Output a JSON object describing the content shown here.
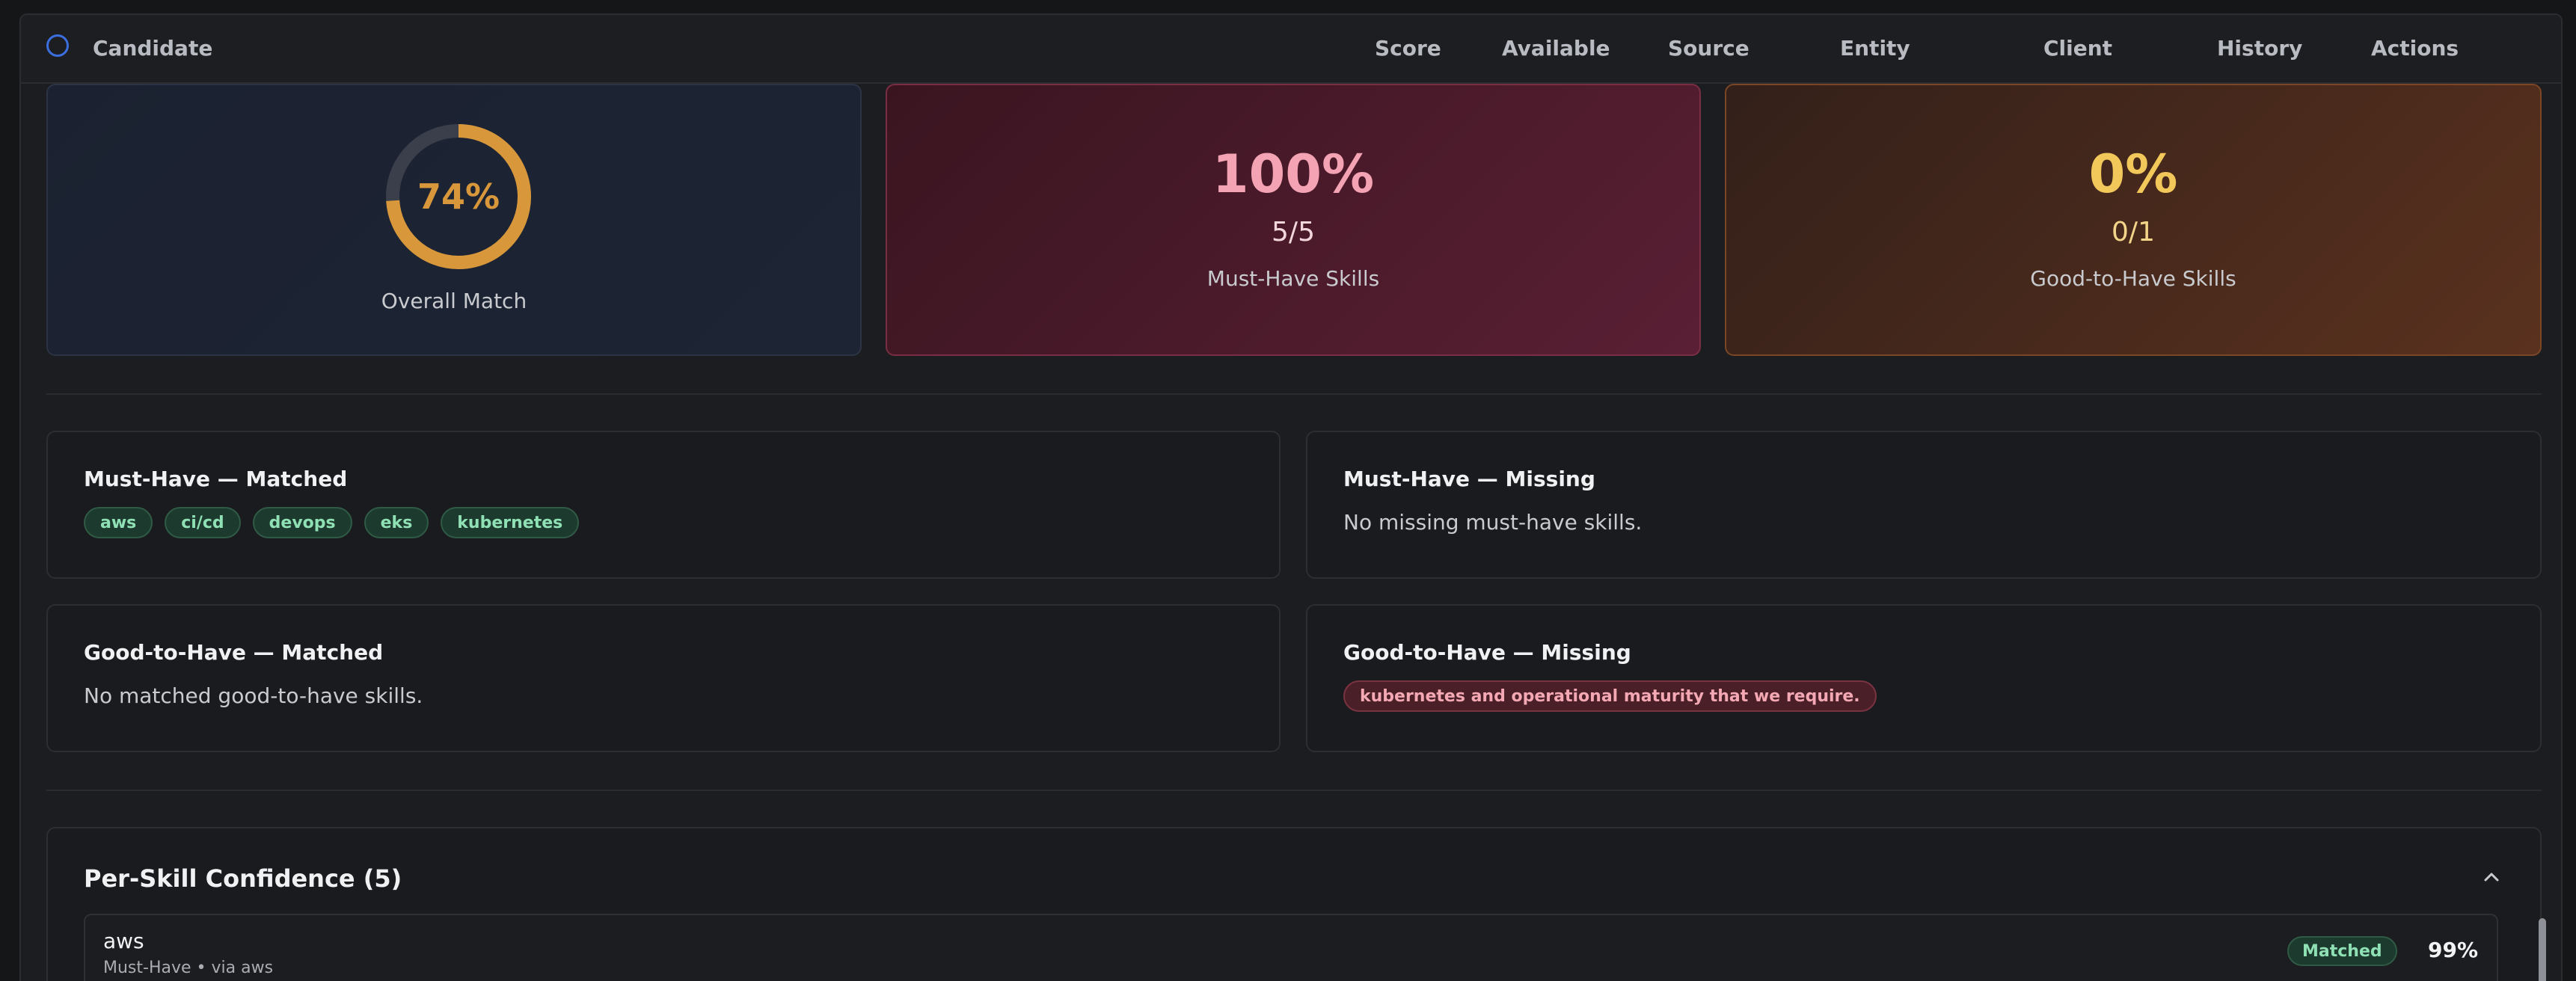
{
  "header": {
    "columns": [
      "Candidate",
      "Score",
      "Available",
      "Source",
      "Entity",
      "Client",
      "History",
      "Actions"
    ]
  },
  "summary": {
    "overall": {
      "percent_label": "74%",
      "label": "Overall Match",
      "value": 0.74,
      "accent": "#d8973a"
    },
    "must_have": {
      "percent": "100%",
      "ratio": "5/5",
      "label": "Must-Have Skills"
    },
    "good_to_have": {
      "percent": "0%",
      "ratio": "0/1",
      "label": "Good-to-Have Skills"
    }
  },
  "must_matched": {
    "title": "Must-Have — Matched",
    "chips": [
      "aws",
      "ci/cd",
      "devops",
      "eks",
      "kubernetes"
    ]
  },
  "must_missing": {
    "title": "Must-Have — Missing",
    "text": "No missing must-have skills."
  },
  "good_matched": {
    "title": "Good-to-Have — Matched",
    "text": "No matched good-to-have skills."
  },
  "good_missing": {
    "title": "Good-to-Have — Missing",
    "chips": [
      "kubernetes and operational maturity that we require."
    ]
  },
  "confidence": {
    "title": "Per-Skill Confidence (5)",
    "rows": [
      {
        "name": "aws",
        "meta": "Must-Have • via aws",
        "status": "Matched",
        "percent": "99%"
      }
    ]
  },
  "icons": {
    "select": "radio-circle-icon",
    "collapse": "chevron-up-icon"
  }
}
